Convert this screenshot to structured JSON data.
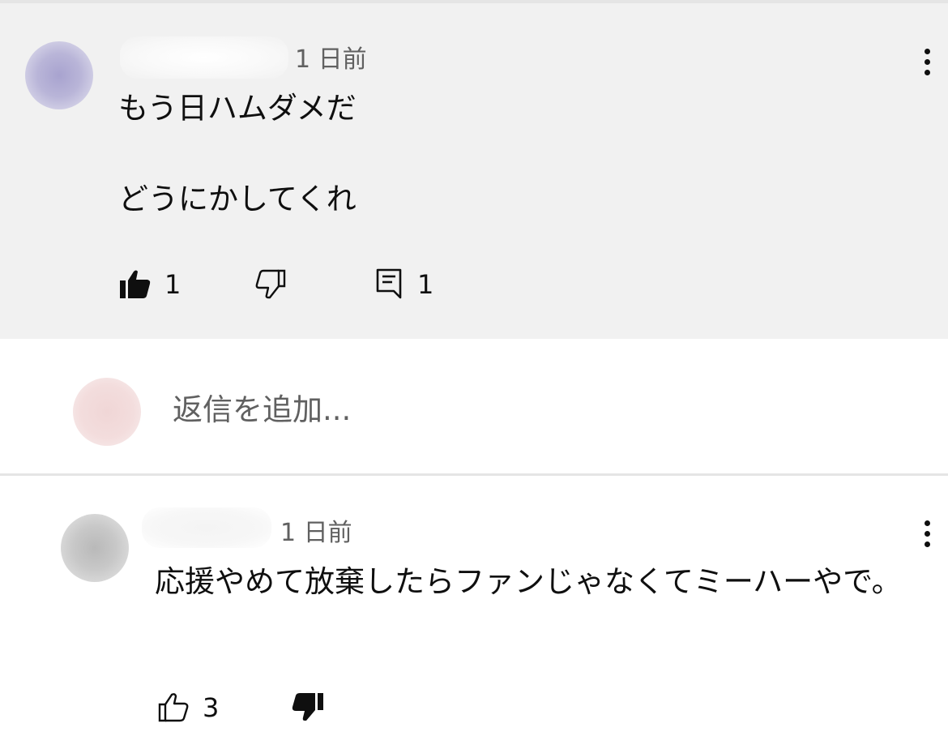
{
  "comments": [
    {
      "time": "1 日前",
      "text": "もう日ハムダメだ\n\nどうにかしてくれ",
      "like_count": "1",
      "reply_count": "1"
    },
    {
      "time": "1 日前",
      "text": "応援やめて放棄したらファンじゃなくてミーハーやで。",
      "like_count": "3"
    }
  ],
  "reply_box": {
    "placeholder": "返信を追加..."
  },
  "icons": {
    "like_filled": "thumb-up-filled-icon",
    "dislike_outline": "thumb-down-outline-icon",
    "reply": "comment-reply-icon",
    "like_outline": "thumb-up-outline-icon",
    "dislike_filled": "thumb-down-filled-icon",
    "menu": "more-vertical-icon"
  },
  "colors": {
    "highlight_background": "#f1f1f1",
    "text_primary": "#0f0f0f",
    "text_secondary": "#606060"
  }
}
